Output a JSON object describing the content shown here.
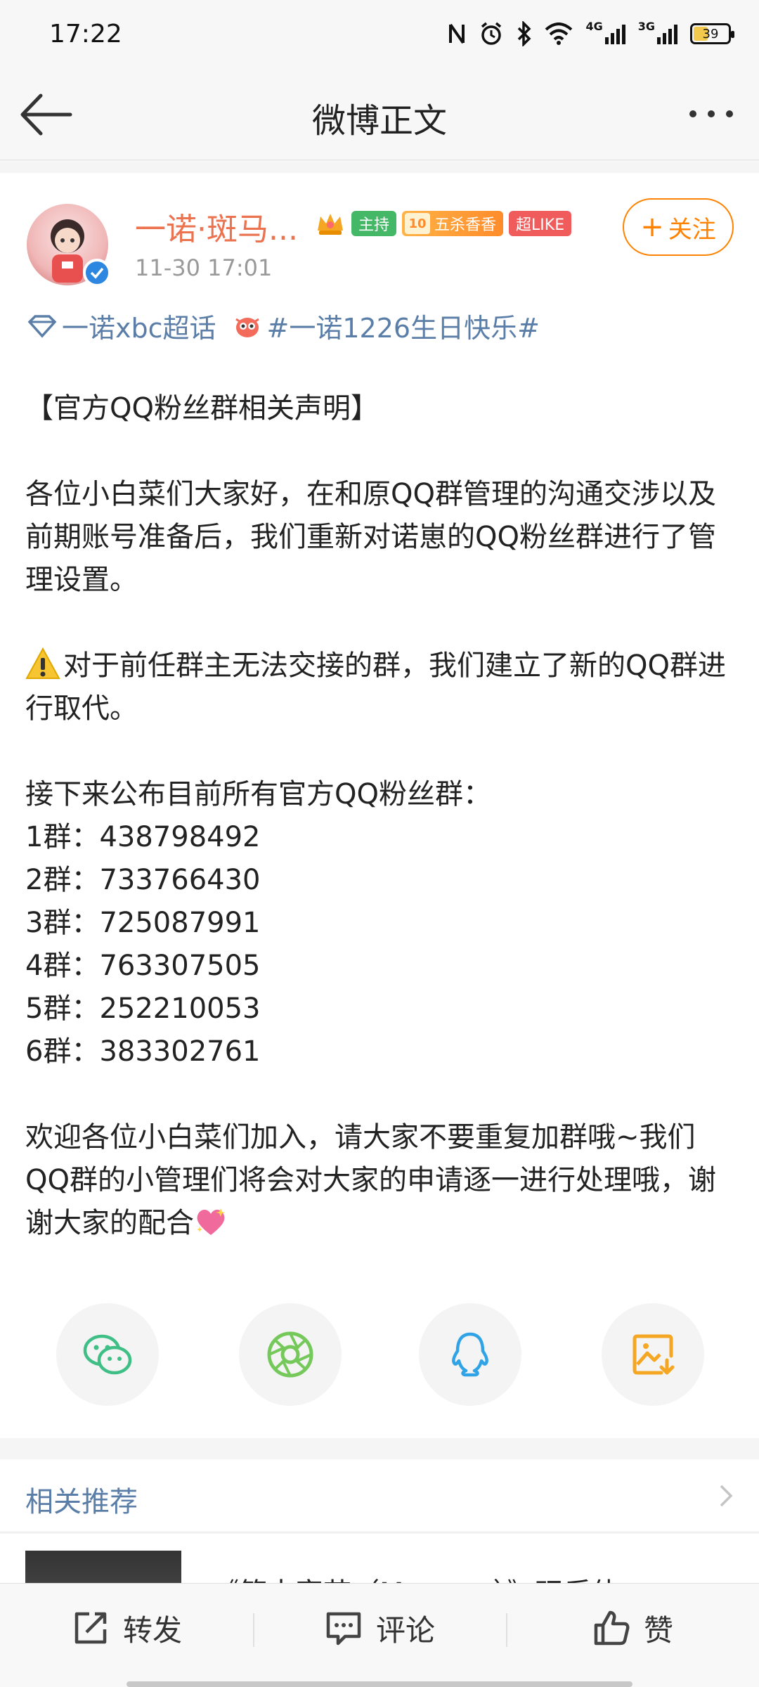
{
  "status_bar": {
    "time": "17:22",
    "net1": "4G",
    "net2": "3G",
    "battery": "39"
  },
  "header": {
    "title": "微博正文"
  },
  "post": {
    "author": "一诺·斑马...",
    "badges": {
      "host": "主持",
      "level": "10",
      "level_text": "五杀香香",
      "like": "超LIKE"
    },
    "time": "11-30 17:01",
    "follow_label": "关注",
    "topics": [
      {
        "label": "一诺xbc超话"
      },
      {
        "label": "#一诺1226生日快乐#"
      }
    ],
    "content": {
      "headline": "【官方QQ粉丝群相关声明】",
      "para1": "各位小白菜们大家好，在和原QQ群管理的沟通交涉以及前期账号准备后，我们重新对诺崽的QQ粉丝群进行了管理设置。",
      "para2": "对于前任群主无法交接的群，我们建立了新的QQ群进行取代。",
      "list_intro": "接下来公布目前所有官方QQ粉丝群：",
      "groups": [
        "1群：438798492",
        "2群：733766430",
        "3群：725087991",
        "4群：763307505",
        "5群：252210053",
        "6群：383302761"
      ],
      "closing": "欢迎各位小白菜们加入，请大家不要重复加群哦~我们QQ群的小管理们将会对大家的申请逐一进行处理哦，谢谢大家的配合"
    },
    "share_icons": [
      "wechat-icon",
      "moments-icon",
      "qq-icon",
      "save-image-icon"
    ]
  },
  "related": {
    "title": "相关推荐",
    "item_title": "《第十家节（M..........）》玩后体"
  },
  "toolbar": {
    "repost": "转发",
    "comment": "评论",
    "like": "赞"
  },
  "colors": {
    "accent_orange": "#ff8200",
    "author_orange": "#eb7350",
    "link_blue": "#5a7ea8"
  }
}
